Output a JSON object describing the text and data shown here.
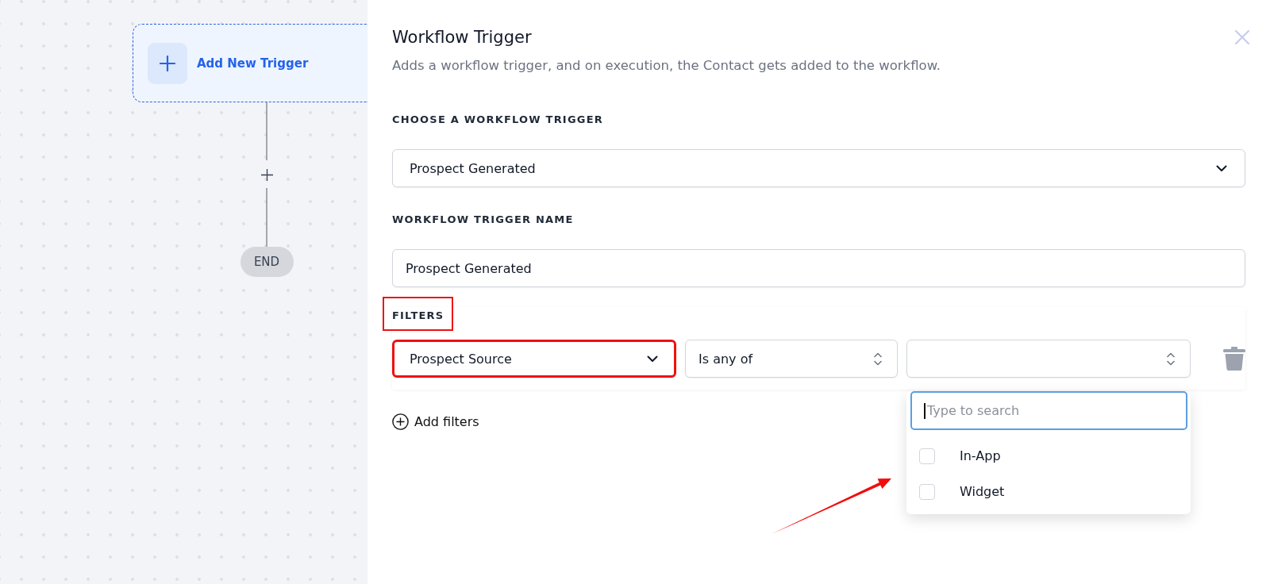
{
  "canvas": {
    "trigger_node": {
      "label": "Add New Trigger"
    },
    "end_node": {
      "label": "END"
    }
  },
  "panel": {
    "title": "Workflow Trigger",
    "subtitle": "Adds a workflow trigger, and on execution, the Contact gets added to the workflow.",
    "fields": [
      {
        "kind": "select",
        "label": "CHOOSE A WORKFLOW TRIGGER",
        "value": "Prospect Generated"
      },
      {
        "kind": "text",
        "label": "WORKFLOW TRIGGER NAME",
        "value": "Prospect Generated"
      }
    ]
  },
  "filters": {
    "label": "FILTERS",
    "highlighted": true,
    "rows": [
      {
        "property": {
          "value": "Prospect Source",
          "highlighted": true
        },
        "operator": {
          "value": "Is any of"
        },
        "values": {
          "open": true,
          "search": {
            "placeholder": "Type to search",
            "focused": true
          },
          "options": [
            {
              "label": "In-App",
              "checked": false
            },
            {
              "label": "Widget",
              "checked": false
            }
          ]
        }
      }
    ],
    "add_button": "Add filters"
  },
  "annotations": [
    {
      "kind": "arrow"
    }
  ]
}
